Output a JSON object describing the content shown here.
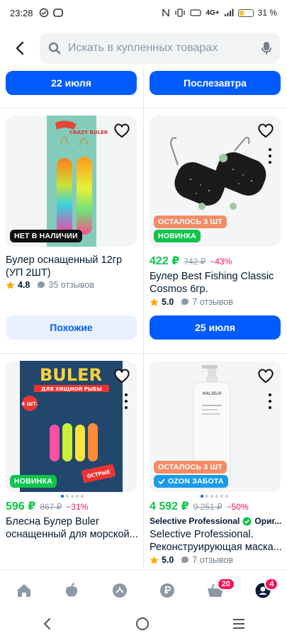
{
  "status_bar": {
    "time": "23:28",
    "network": "4G+",
    "battery_text": "31 %"
  },
  "search": {
    "placeholder": "Искать в купленных товарах"
  },
  "top_buttons": {
    "left": "22 июля",
    "right": "Послезавтра"
  },
  "products": [
    {
      "image_alt": "CRAZY BULER",
      "badges": [
        "НЕТ В НАЛИЧИИ"
      ],
      "title": "Булер оснащенный 12гр (УП 2ШТ)",
      "rating": "4.8",
      "reviews": "35 отзывов",
      "button": "Похожие",
      "button_style": "light"
    },
    {
      "badges": [
        "ОСТАЛОСЬ 3 ШТ",
        "НОВИНКА"
      ],
      "price": "422 ₽",
      "old_price": "742 ₽",
      "discount": "−43%",
      "title": "Булер Best Fishing Classic Cosmos 6гр.",
      "rating": "5.0",
      "reviews": "7 отзывов",
      "button": "25 июля",
      "button_style": "primary"
    },
    {
      "image_text": {
        "brand": "BULER",
        "subtitle": "ДЛЯ ХИЩНОЙ РЫБЫ",
        "count": "4 ШТ.",
        "sticker": "ОСТРЫЕ"
      },
      "badges": [
        "НОВИНКА"
      ],
      "price": "596 ₽",
      "old_price": "867 ₽",
      "discount": "−31%",
      "title": "Блесна Булер Buler оснащенный для морской...",
      "carousel_dots": 5
    },
    {
      "image_text": {
        "brand": "MALIBUR"
      },
      "badges": [
        "ОСТАЛОСЬ 3 ШТ",
        "OZON ЗАБОТА"
      ],
      "price": "4 592 ₽",
      "old_price": "9 251 ₽",
      "discount": "−50%",
      "seller": "Selective Professional",
      "seller_suffix": "Ориг...",
      "title": "Selective Professional. Реконструирующая маска...",
      "rating": "5.0",
      "reviews": "7 отзывов",
      "carousel_dots": 6
    }
  ],
  "bottom_nav": {
    "items": [
      "home-icon",
      "fresh-icon",
      "catalog-icon",
      "finance-icon",
      "cart-icon",
      "profile-icon"
    ],
    "cart_badge": "20",
    "profile_badge": "4"
  },
  "colors": {
    "primary": "#005bff",
    "price_green": "#10c44c",
    "discount_red": "#f91155",
    "badge_orange": "#f28c66"
  }
}
